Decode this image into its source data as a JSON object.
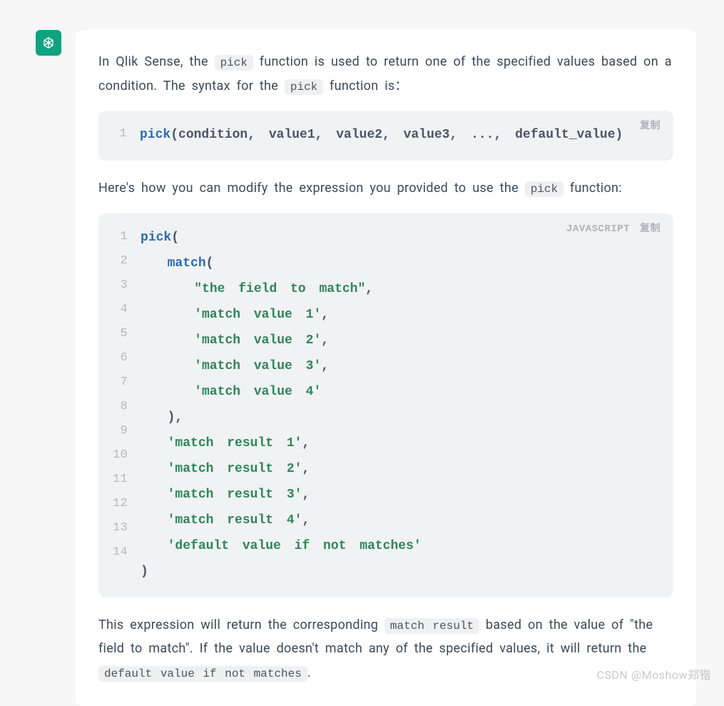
{
  "avatar": {
    "icon": "openai-logo"
  },
  "para1": {
    "t1": "In Qlik Sense, the ",
    "code1": "pick",
    "t2": " function is used to return one of the specified values based on a condition. The syntax for the ",
    "code2": "pick",
    "t3": " function is：",
    "t3_colon": "："
  },
  "code1": {
    "copyLabel": "复制",
    "lines": [
      {
        "num": "1",
        "tokens": [
          {
            "t": "pick",
            "c": "tok-fn"
          },
          {
            "t": "(condition, value1, value2, value3, ..., default_value)",
            "c": "tok-plain"
          }
        ]
      }
    ]
  },
  "para2": {
    "t1": "Here's how you can modify the expression you provided to use the ",
    "code1": "pick",
    "t2": " function:"
  },
  "code2": {
    "langLabel": "JAVASCRIPT",
    "copyLabel": "复制",
    "lines": [
      {
        "num": "1",
        "tokens": [
          {
            "t": "pick",
            "c": "tok-fn"
          },
          {
            "t": "(",
            "c": "tok-punc"
          }
        ]
      },
      {
        "num": "2",
        "tokens": [
          {
            "t": "  ",
            "c": "tok-plain"
          },
          {
            "t": "match",
            "c": "tok-fn"
          },
          {
            "t": "(",
            "c": "tok-punc"
          }
        ]
      },
      {
        "num": "3",
        "tokens": [
          {
            "t": "    ",
            "c": "tok-plain"
          },
          {
            "t": "\"the field to match\"",
            "c": "tok-str"
          },
          {
            "t": ",",
            "c": "tok-punc"
          }
        ]
      },
      {
        "num": "4",
        "tokens": [
          {
            "t": "    ",
            "c": "tok-plain"
          },
          {
            "t": "'match value 1'",
            "c": "tok-str"
          },
          {
            "t": ",",
            "c": "tok-punc"
          }
        ]
      },
      {
        "num": "5",
        "tokens": [
          {
            "t": "    ",
            "c": "tok-plain"
          },
          {
            "t": "'match value 2'",
            "c": "tok-str"
          },
          {
            "t": ",",
            "c": "tok-punc"
          }
        ]
      },
      {
        "num": "6",
        "tokens": [
          {
            "t": "    ",
            "c": "tok-plain"
          },
          {
            "t": "'match value 3'",
            "c": "tok-str"
          },
          {
            "t": ",",
            "c": "tok-punc"
          }
        ]
      },
      {
        "num": "7",
        "tokens": [
          {
            "t": "    ",
            "c": "tok-plain"
          },
          {
            "t": "'match value 4'",
            "c": "tok-str"
          }
        ]
      },
      {
        "num": "8",
        "tokens": [
          {
            "t": "  ),",
            "c": "tok-punc"
          }
        ]
      },
      {
        "num": "9",
        "tokens": [
          {
            "t": "  ",
            "c": "tok-plain"
          },
          {
            "t": "'match result 1'",
            "c": "tok-str"
          },
          {
            "t": ",",
            "c": "tok-punc"
          }
        ]
      },
      {
        "num": "10",
        "tokens": [
          {
            "t": "  ",
            "c": "tok-plain"
          },
          {
            "t": "'match result 2'",
            "c": "tok-str"
          },
          {
            "t": ",",
            "c": "tok-punc"
          }
        ]
      },
      {
        "num": "11",
        "tokens": [
          {
            "t": "  ",
            "c": "tok-plain"
          },
          {
            "t": "'match result 3'",
            "c": "tok-str"
          },
          {
            "t": ",",
            "c": "tok-punc"
          }
        ]
      },
      {
        "num": "12",
        "tokens": [
          {
            "t": "  ",
            "c": "tok-plain"
          },
          {
            "t": "'match result 4'",
            "c": "tok-str"
          },
          {
            "t": ",",
            "c": "tok-punc"
          }
        ]
      },
      {
        "num": "13",
        "tokens": [
          {
            "t": "  ",
            "c": "tok-plain"
          },
          {
            "t": "'default value if not matches'",
            "c": "tok-str"
          }
        ]
      },
      {
        "num": "14",
        "tokens": [
          {
            "t": ")",
            "c": "tok-punc"
          }
        ]
      }
    ]
  },
  "para3": {
    "t1": "This expression will return the corresponding ",
    "code1": "match result",
    "t2": " based on the value of \"the field to match\". If the value doesn't match any of the specified values, it will return the ",
    "code2": "default value if not matches",
    "t3": "."
  },
  "watermark": "CSDN @Moshow郑锴"
}
